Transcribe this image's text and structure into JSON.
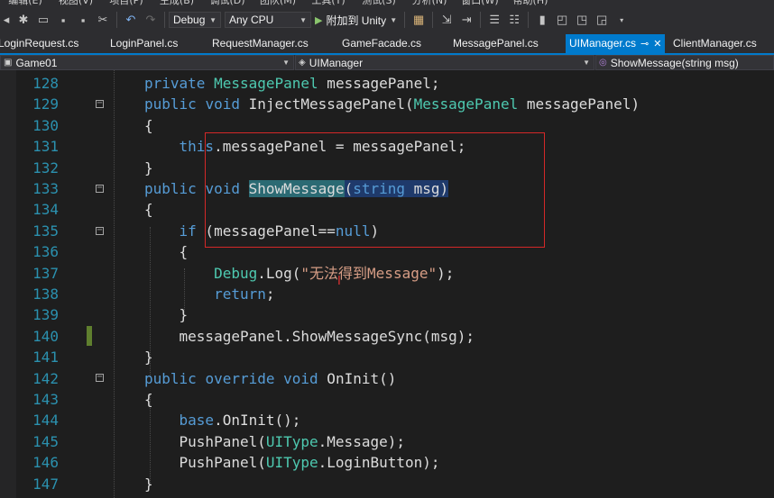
{
  "menu": {
    "items": [
      "编辑(E)",
      "视图(V)",
      "项目(P)",
      "生成(B)",
      "调试(D)",
      "团队(M)",
      "工具(T)",
      "测试(S)",
      "分析(N)",
      "窗口(W)",
      "帮助(H)"
    ]
  },
  "toolbar": {
    "config_value": "Debug",
    "platform_value": "Any CPU",
    "run_label": "附加到 Unity"
  },
  "tabs": [
    {
      "label": "LoginRequest.cs",
      "active": false
    },
    {
      "label": "LoginPanel.cs",
      "active": false
    },
    {
      "label": "RequestManager.cs",
      "active": false
    },
    {
      "label": "GameFacade.cs",
      "active": false
    },
    {
      "label": "MessagePanel.cs",
      "active": false
    },
    {
      "label": "UIManager.cs",
      "active": true
    },
    {
      "label": "ClientManager.cs",
      "active": false
    }
  ],
  "navbar": {
    "project": "Game01",
    "type": "UIManager",
    "member": "ShowMessage(string msg)"
  },
  "editor": {
    "line_numbers": [
      "128",
      "129",
      "130",
      "131",
      "132",
      "133",
      "134",
      "135",
      "136",
      "137",
      "138",
      "139",
      "140",
      "141",
      "142",
      "143",
      "144",
      "145",
      "146",
      "147"
    ],
    "colors": {
      "keyword": "#569cd6",
      "type": "#4ec9b0",
      "string": "#d69d85",
      "line_number": "#2b91af",
      "annotation": "#d42828",
      "accent": "#007acc"
    }
  }
}
